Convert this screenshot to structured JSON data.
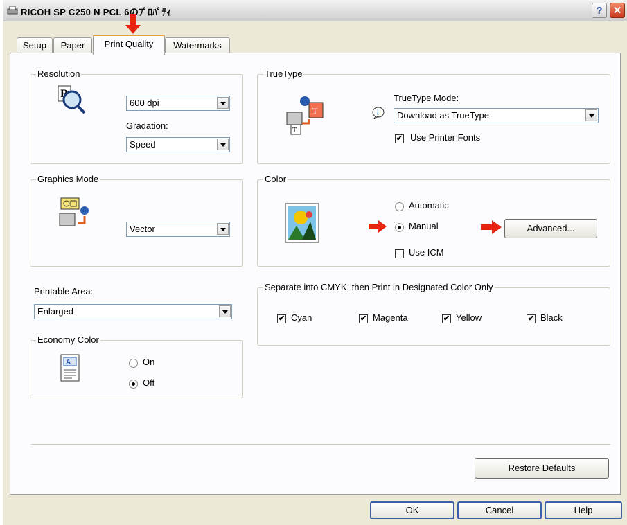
{
  "window": {
    "title": "RICOH SP C250█N PCL 6のプロパティ",
    "title_display": "RICOH SP C250  N PCL 6のﾌﾟﾛﾊﾟﾃｨ",
    "help_glyph": "?",
    "close_glyph": "✕"
  },
  "tabs": [
    {
      "label": "Setup"
    },
    {
      "label": "Paper"
    },
    {
      "label": "Print Quality",
      "active": true
    },
    {
      "label": "Watermarks"
    }
  ],
  "resolution": {
    "title": "Resolution",
    "value": "600 dpi",
    "gradation_label": "Gradation:",
    "gradation_value": "Speed"
  },
  "truetype": {
    "title": "TrueType",
    "mode_label": "TrueType Mode:",
    "mode_value": "Download as TrueType",
    "use_printer_fonts_label": "Use Printer Fonts",
    "use_printer_fonts": true
  },
  "graphics": {
    "title": "Graphics Mode",
    "value": "Vector"
  },
  "color": {
    "title": "Color",
    "automatic_label": "Automatic",
    "manual_label": "Manual",
    "selected": "Manual",
    "advanced_label": "Advanced...",
    "use_icm_label": "Use ICM",
    "use_icm": false
  },
  "printable": {
    "label": "Printable Area:",
    "value": "Enlarged"
  },
  "cmyk": {
    "title": "Separate into CMYK, then Print in Designated Color Only",
    "cyan": "Cyan",
    "magenta": "Magenta",
    "yellow": "Yellow",
    "black": "Black",
    "check_mark": "✔"
  },
  "economy": {
    "title": "Economy Color",
    "on_label": "On",
    "off_label": "Off",
    "selected": "Off"
  },
  "buttons": {
    "restore": "Restore Defaults",
    "ok": "OK",
    "cancel": "Cancel",
    "help": "Help"
  },
  "colors": {
    "annotation_arrow": "#e8230f",
    "tab_highlight": "#f0a030",
    "face": "#ece9d8",
    "panel": "#fcfcfe"
  }
}
